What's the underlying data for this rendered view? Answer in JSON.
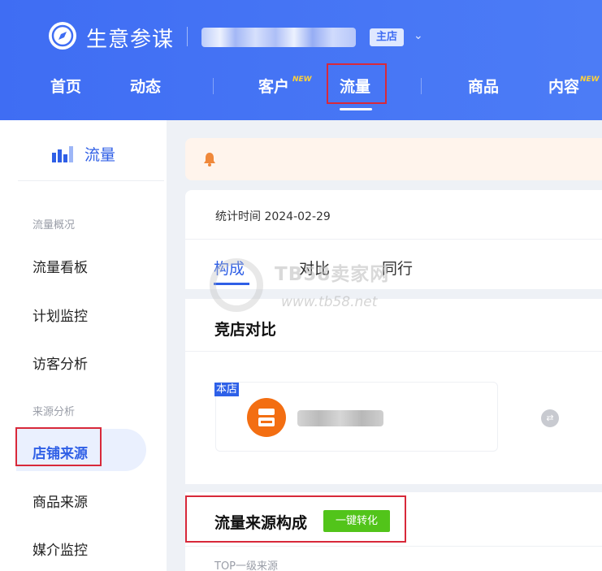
{
  "header": {
    "brand": "生意参谋",
    "store_badge": "主店",
    "nav": [
      {
        "label": "首页"
      },
      {
        "label": "动态"
      },
      {
        "label": "客户",
        "badge": "NEW"
      },
      {
        "label": "流量"
      },
      {
        "label": "商品"
      },
      {
        "label": "内容",
        "badge": "NEW"
      }
    ],
    "active_nav": "流量"
  },
  "sidebar": {
    "title": "流量",
    "groups": [
      {
        "title": "流量概况",
        "items": [
          "流量看板",
          "计划监控",
          "访客分析"
        ]
      },
      {
        "title": "来源分析",
        "items": [
          "店铺来源",
          "商品来源",
          "媒介监控"
        ]
      }
    ],
    "active_item": "店铺来源"
  },
  "main": {
    "stat_time": "统计时间 2024-02-29",
    "tabs": [
      "构成",
      "对比",
      "同行"
    ],
    "active_tab": "构成",
    "compare_card": {
      "title": "竞店对比",
      "own_label": "本店"
    },
    "source_card": {
      "title": "流量来源构成",
      "button": "一键转化",
      "sub_label": "TOP一级来源"
    }
  },
  "watermark": {
    "text": "TB58卖家网",
    "url": "www.tb58.net"
  },
  "colors": {
    "header_bg": "#4373f5",
    "accent": "#2f5fe6",
    "highlight_box": "#d8293a",
    "convert_button": "#52c41a",
    "store_avatar": "#f36e12",
    "new_badge": "#ffd13a"
  }
}
